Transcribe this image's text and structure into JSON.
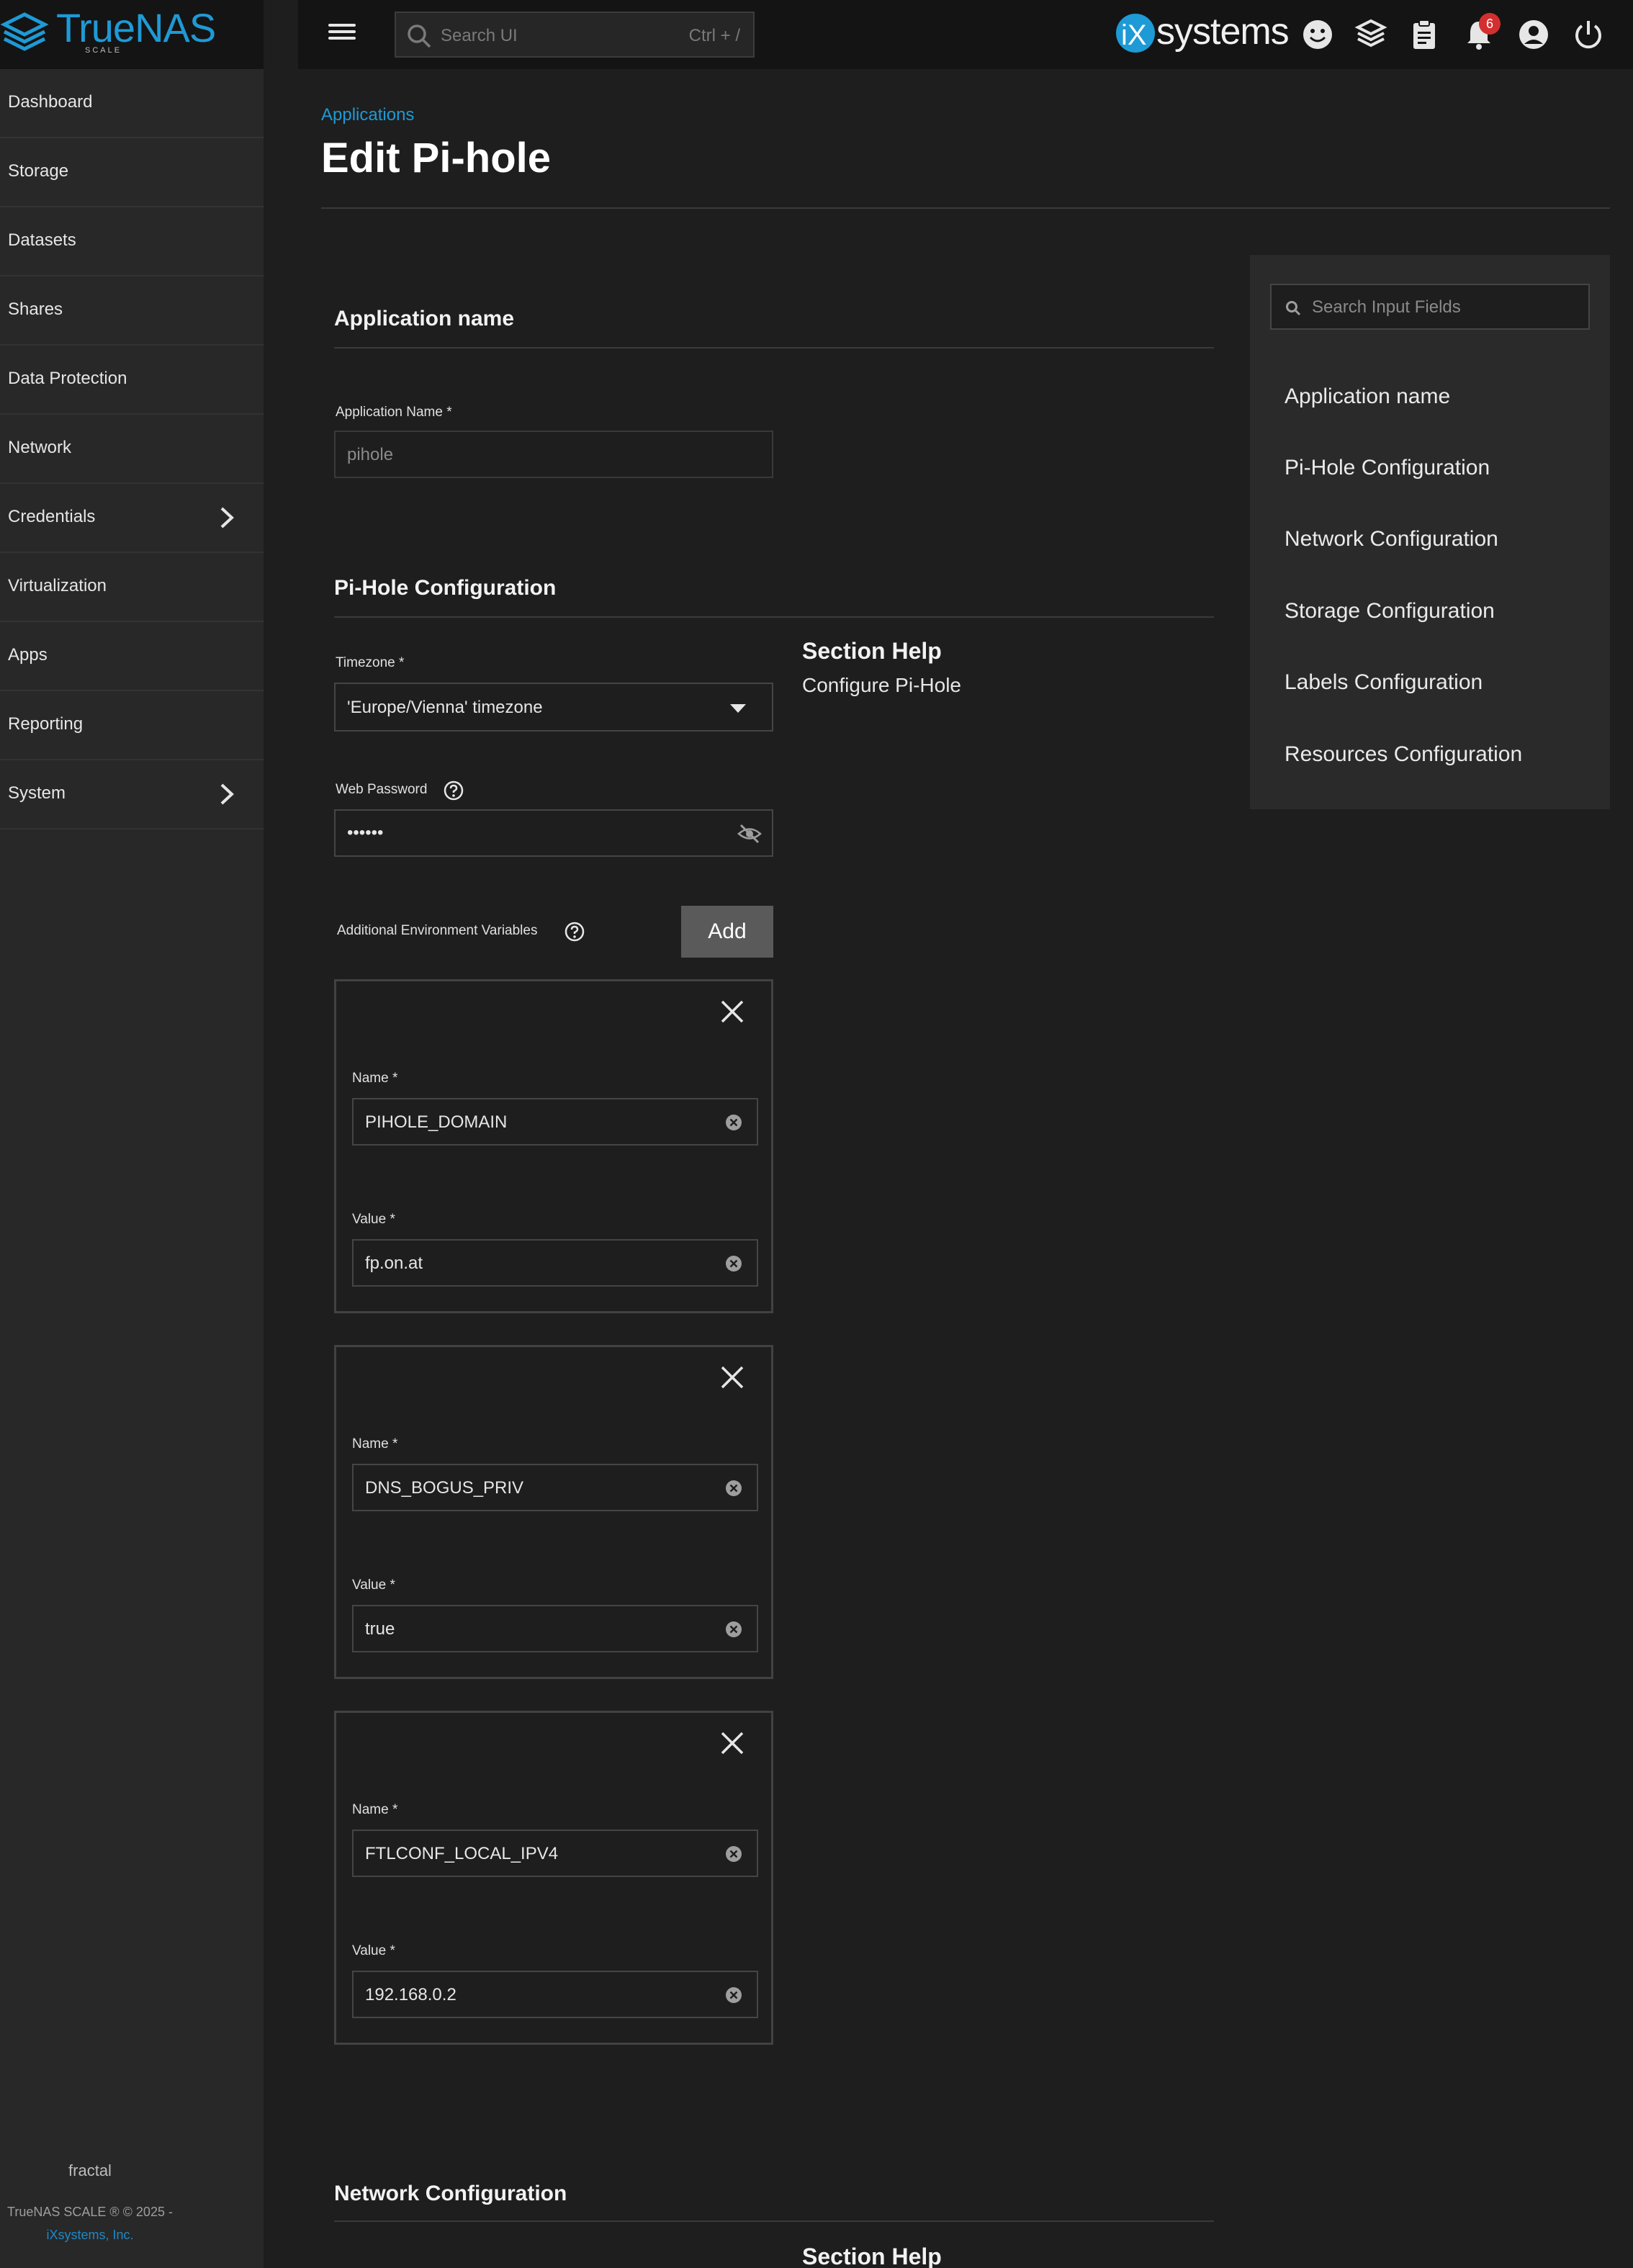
{
  "brand": {
    "name": "TrueNAS",
    "edition": "SCALE"
  },
  "topbar": {
    "search_placeholder": "Search UI",
    "search_shortcut": "Ctrl + /",
    "vendor": "systems",
    "notification_count": "6"
  },
  "sidebar": {
    "items": [
      {
        "label": "Dashboard"
      },
      {
        "label": "Storage"
      },
      {
        "label": "Datasets"
      },
      {
        "label": "Shares"
      },
      {
        "label": "Data Protection"
      },
      {
        "label": "Network"
      },
      {
        "label": "Credentials"
      },
      {
        "label": "Virtualization"
      },
      {
        "label": "Apps"
      },
      {
        "label": "Reporting"
      },
      {
        "label": "System"
      }
    ],
    "footer_host": "fractal",
    "footer_copyright": "TrueNAS SCALE ® © 2025 -",
    "footer_company": "iXsystems, Inc."
  },
  "page": {
    "breadcrumb": "Applications",
    "title": "Edit Pi-hole"
  },
  "form": {
    "app_section": {
      "title": "Application name",
      "name_label": "Application Name *",
      "name_value": "pihole"
    },
    "pihole_section": {
      "title": "Pi-Hole Configuration",
      "timezone_label": "Timezone *",
      "timezone_value": "'Europe/Vienna' timezone",
      "password_label": "Web Password",
      "password_value": "••••••",
      "env_label": "Additional Environment Variables",
      "add_label": "Add",
      "help_title": "Section Help",
      "help_text": "Configure Pi-Hole",
      "env_vars": [
        {
          "name_label": "Name *",
          "name": "PIHOLE_DOMAIN",
          "value_label": "Value *",
          "value": "fp.on.at"
        },
        {
          "name_label": "Name *",
          "name": "DNS_BOGUS_PRIV",
          "value_label": "Value *",
          "value": "true"
        },
        {
          "name_label": "Name *",
          "name": "FTLCONF_LOCAL_IPV4",
          "value_label": "Value *",
          "value": "192.168.0.2"
        }
      ]
    },
    "network_section": {
      "title": "Network Configuration",
      "help_title": "Section Help"
    }
  },
  "field_nav": {
    "search_placeholder": "Search Input Fields",
    "items": [
      "Application name",
      "Pi-Hole Configuration",
      "Network Configuration",
      "Storage Configuration",
      "Labels Configuration",
      "Resources Configuration"
    ]
  },
  "colors": {
    "accent": "#1e9ad6",
    "badge": "#d32f2f",
    "background": "#1e1e1e",
    "sidebar": "#282828"
  }
}
